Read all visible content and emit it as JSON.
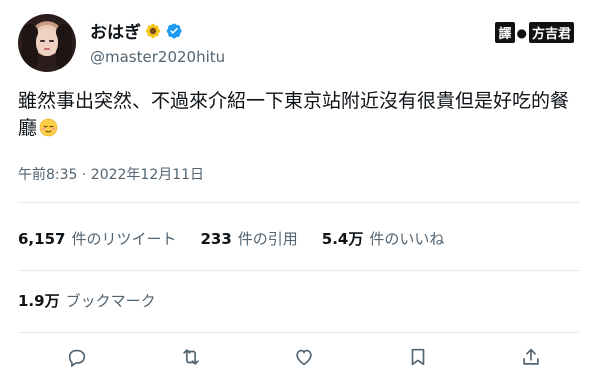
{
  "author": {
    "display_name": "おはぎ",
    "handle": "@master2020hitu",
    "avatar_icon": "avatar",
    "verified_icon": "verified-badge-icon",
    "name_emoji_icon": "sunflower-icon"
  },
  "watermark": {
    "label_1": "譯",
    "label_2": "方吉君"
  },
  "tweet": {
    "text": "雖然事出突然、不過來介紹一下東京站附近沒有很貴但是好吃的餐廳",
    "trailing_emoji_icon": "relieved-face-icon",
    "timestamp": "午前8:35 · 2022年12月11日"
  },
  "stats": {
    "retweets_count": "6,157",
    "retweets_label": "件のリツイート",
    "quotes_count": "233",
    "quotes_label": "件の引用",
    "likes_count": "5.4万",
    "likes_label": "件のいいね",
    "bookmarks_count": "1.9万",
    "bookmarks_label": "ブックマーク"
  },
  "actions": [
    "reply-icon",
    "retweet-icon",
    "like-icon",
    "bookmark-icon",
    "share-icon"
  ],
  "colors": {
    "text_primary": "#0f1419",
    "text_secondary": "#536471",
    "verified_blue": "#1d9bf0",
    "divider": "#e6ebee"
  }
}
